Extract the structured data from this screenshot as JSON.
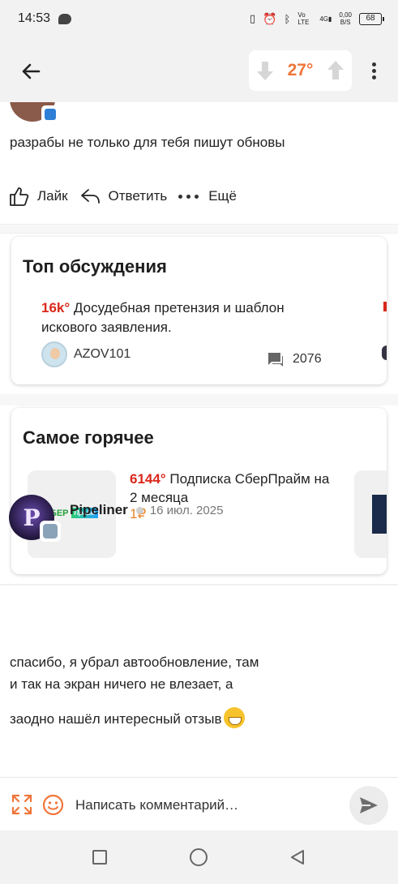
{
  "status_bar": {
    "time": "14:53",
    "battery": "68",
    "net_speed": "0,00",
    "net_unit": "B/S",
    "lte": "Vo LTE",
    "signal": "4G"
  },
  "header": {
    "temperature": "27°"
  },
  "first_comment": {
    "text": "разрабы не только для тебя пишут обновы",
    "like_label": "Лайк",
    "reply_label": "Ответить",
    "more_label": "Ещё"
  },
  "top_discussions": {
    "title": "Топ обсуждения",
    "item": {
      "rating": "16k°",
      "title": "Досудебная претензия и шаблон искового заявления.",
      "author": "AZOV101",
      "comments": "2076"
    }
  },
  "hottest": {
    "title": "Самое горячее",
    "item": {
      "rating": "6144°",
      "title": "Подписка СберПрайм на 2 месяца",
      "price": "1₽",
      "logo_text": "СБЕР",
      "logo_badge": "Прайм"
    }
  },
  "second_comment": {
    "username": "Pipeliner",
    "date": "16 июл. 2025",
    "line1": "спасибо, я убрал автообновление, там",
    "line2": "и так на экран ничего не влезает, а",
    "line3": "заодно нашёл интересный отзыв"
  },
  "comment_bar": {
    "placeholder": "Написать комментарий…"
  },
  "colors": {
    "hot_red": "#d9281c",
    "accent_orange": "#f0753a",
    "price_orange": "#e8862a"
  },
  "icons": [
    "back-arrow-icon",
    "vote-down-icon",
    "vote-up-icon",
    "more-vert-icon",
    "thumb-up-icon",
    "reply-icon",
    "comments-icon",
    "expand-icon",
    "emoji-icon",
    "send-icon"
  ]
}
